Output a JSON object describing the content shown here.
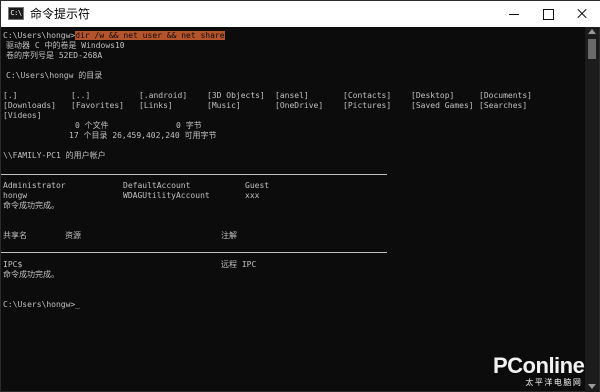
{
  "window": {
    "app_icon_text": "C:\\",
    "title": "命令提示符"
  },
  "console": {
    "prompt": "C:\\Users\\hongw>",
    "command": "dir /w && net user && net share",
    "volume_line": "驱动器 C 中的卷是 Windows10",
    "serial_line": "卷的序列号是 52ED-268A",
    "dir_header": "C:\\Users\\hongw 的目录",
    "dir_items": [
      [
        "[.]",
        "[..]",
        "[.android]",
        "[3D Objects]",
        "[ansel]",
        "[Contacts]",
        "[Desktop]",
        "[Documents]"
      ],
      [
        "[Downloads]",
        "[Favorites]",
        "[Links]",
        "[Music]",
        "[OneDrive]",
        "[Pictures]",
        "[Saved Games]",
        "[Searches]"
      ],
      [
        "[Videos]"
      ]
    ],
    "files_summary": "0 个文件              0 字节",
    "dirs_summary": "17 个目录 26,459,402,240 可用字节",
    "user_accounts_header": "\\\\FAMILY-PC1 的用户帐户",
    "users": [
      [
        "Administrator",
        "DefaultAccount",
        "Guest"
      ],
      [
        "hongw",
        "WDAGUtilityAccount",
        "xxx"
      ]
    ],
    "success_1": "命令成功完成。",
    "share_headers": [
      "共享名",
      "资源",
      "注解"
    ],
    "shares": [
      [
        "IPC$",
        "",
        "远程 IPC"
      ]
    ],
    "success_2": "命令成功完成。",
    "final_prompt": "C:\\Users\\hongw>_"
  },
  "watermark": {
    "brand": "PConline",
    "subtitle": "太平洋电脑网"
  }
}
